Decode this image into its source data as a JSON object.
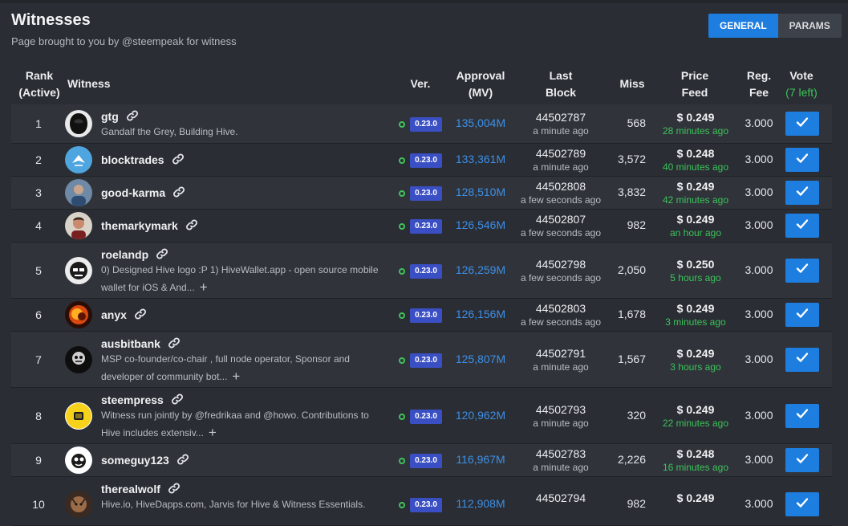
{
  "header": {
    "title": "Witnesses",
    "subtitle": "Page brought to you by @steempeak for witness",
    "tabs": [
      {
        "label": "GENERAL",
        "active": true
      },
      {
        "label": "PARAMS",
        "active": false
      }
    ]
  },
  "columns": {
    "rank": "Rank",
    "rank_sub": "(Active)",
    "witness": "Witness",
    "version": "Ver.",
    "approval": "Approval",
    "approval_sub": "(MV)",
    "last_block": "Last",
    "last_block_sub": "Block",
    "miss": "Miss",
    "price_feed": "Price",
    "price_feed_sub": "Feed",
    "reg_fee": "Reg.",
    "reg_fee_sub": "Fee",
    "vote": "Vote",
    "vote_sub": "(7 left)"
  },
  "colors": {
    "accent": "#1e7ee0",
    "approval": "#3e8fe6",
    "green": "#3cc35a",
    "version_badge": "#3b4fc4",
    "background": "#2a2d33"
  },
  "witnesses": [
    {
      "rank": "1",
      "name": "gtg",
      "avatar": "dark-hooded-avatar",
      "desc": "Gandalf the Grey, Building Hive.",
      "more": false,
      "version": "0.23.0",
      "approval": "135,004M",
      "last_block": "44502787",
      "last_block_time": "a minute ago",
      "miss": "568",
      "price": "$ 0.249",
      "price_time": "28 minutes ago",
      "fee": "3.000"
    },
    {
      "rank": "2",
      "name": "blocktrades",
      "avatar": "blue-bird-avatar",
      "desc": "",
      "more": false,
      "version": "0.23.0",
      "approval": "133,361M",
      "last_block": "44502789",
      "last_block_time": "a minute ago",
      "miss": "3,572",
      "price": "$ 0.248",
      "price_time": "40 minutes ago",
      "fee": "3.000"
    },
    {
      "rank": "3",
      "name": "good-karma",
      "avatar": "photo-avatar",
      "desc": "",
      "more": false,
      "version": "0.23.0",
      "approval": "128,510M",
      "last_block": "44502808",
      "last_block_time": "a few seconds ago",
      "miss": "3,832",
      "price": "$ 0.249",
      "price_time": "42 minutes ago",
      "fee": "3.000"
    },
    {
      "rank": "4",
      "name": "themarkymark",
      "avatar": "portrait-avatar",
      "desc": "",
      "more": false,
      "version": "0.23.0",
      "approval": "126,546M",
      "last_block": "44502807",
      "last_block_time": "a few seconds ago",
      "miss": "982",
      "price": "$ 0.249",
      "price_time": "an hour ago",
      "fee": "3.000"
    },
    {
      "rank": "5",
      "name": "roelandp",
      "avatar": "mono-face-avatar",
      "desc": "0) Designed Hive logo :P 1) HiveWallet.app - open source mobile wallet for iOS & And...",
      "more": true,
      "version": "0.23.0",
      "approval": "126,259M",
      "last_block": "44502798",
      "last_block_time": "a few seconds ago",
      "miss": "2,050",
      "price": "$ 0.250",
      "price_time": "5 hours ago",
      "fee": "3.000"
    },
    {
      "rank": "6",
      "name": "anyx",
      "avatar": "fire-avatar",
      "desc": "",
      "more": false,
      "version": "0.23.0",
      "approval": "126,156M",
      "last_block": "44502803",
      "last_block_time": "a few seconds ago",
      "miss": "1,678",
      "price": "$ 0.249",
      "price_time": "3 minutes ago",
      "fee": "3.000"
    },
    {
      "rank": "7",
      "name": "ausbitbank",
      "avatar": "dark-face-avatar",
      "desc": "MSP co-founder/co-chair , full node operator, Sponsor and developer of community bot...",
      "more": true,
      "version": "0.23.0",
      "approval": "125,807M",
      "last_block": "44502791",
      "last_block_time": "a minute ago",
      "miss": "1,567",
      "price": "$ 0.249",
      "price_time": "3 hours ago",
      "fee": "3.000"
    },
    {
      "rank": "8",
      "name": "steempress",
      "avatar": "yellow-logo-avatar",
      "desc": "Witness run jointly by @fredrikaa and @howo. Contributions to Hive includes extensiv...",
      "more": true,
      "version": "0.23.0",
      "approval": "120,962M",
      "last_block": "44502793",
      "last_block_time": "a minute ago",
      "miss": "320",
      "price": "$ 0.249",
      "price_time": "22 minutes ago",
      "fee": "3.000"
    },
    {
      "rank": "9",
      "name": "someguy123",
      "avatar": "cartoon-avatar",
      "desc": "",
      "more": false,
      "version": "0.23.0",
      "approval": "116,967M",
      "last_block": "44502783",
      "last_block_time": "a minute ago",
      "miss": "2,226",
      "price": "$ 0.248",
      "price_time": "16 minutes ago",
      "fee": "3.000"
    },
    {
      "rank": "10",
      "name": "therealwolf",
      "avatar": "wolf-avatar",
      "desc": "Hive.io, HiveDapps.com, Jarvis for Hive & Witness Essentials.",
      "more": false,
      "version": "0.23.0",
      "approval": "112,908M",
      "last_block": "44502794",
      "last_block_time": "",
      "miss": "982",
      "price": "$ 0.249",
      "price_time": "",
      "fee": "3.000"
    }
  ]
}
